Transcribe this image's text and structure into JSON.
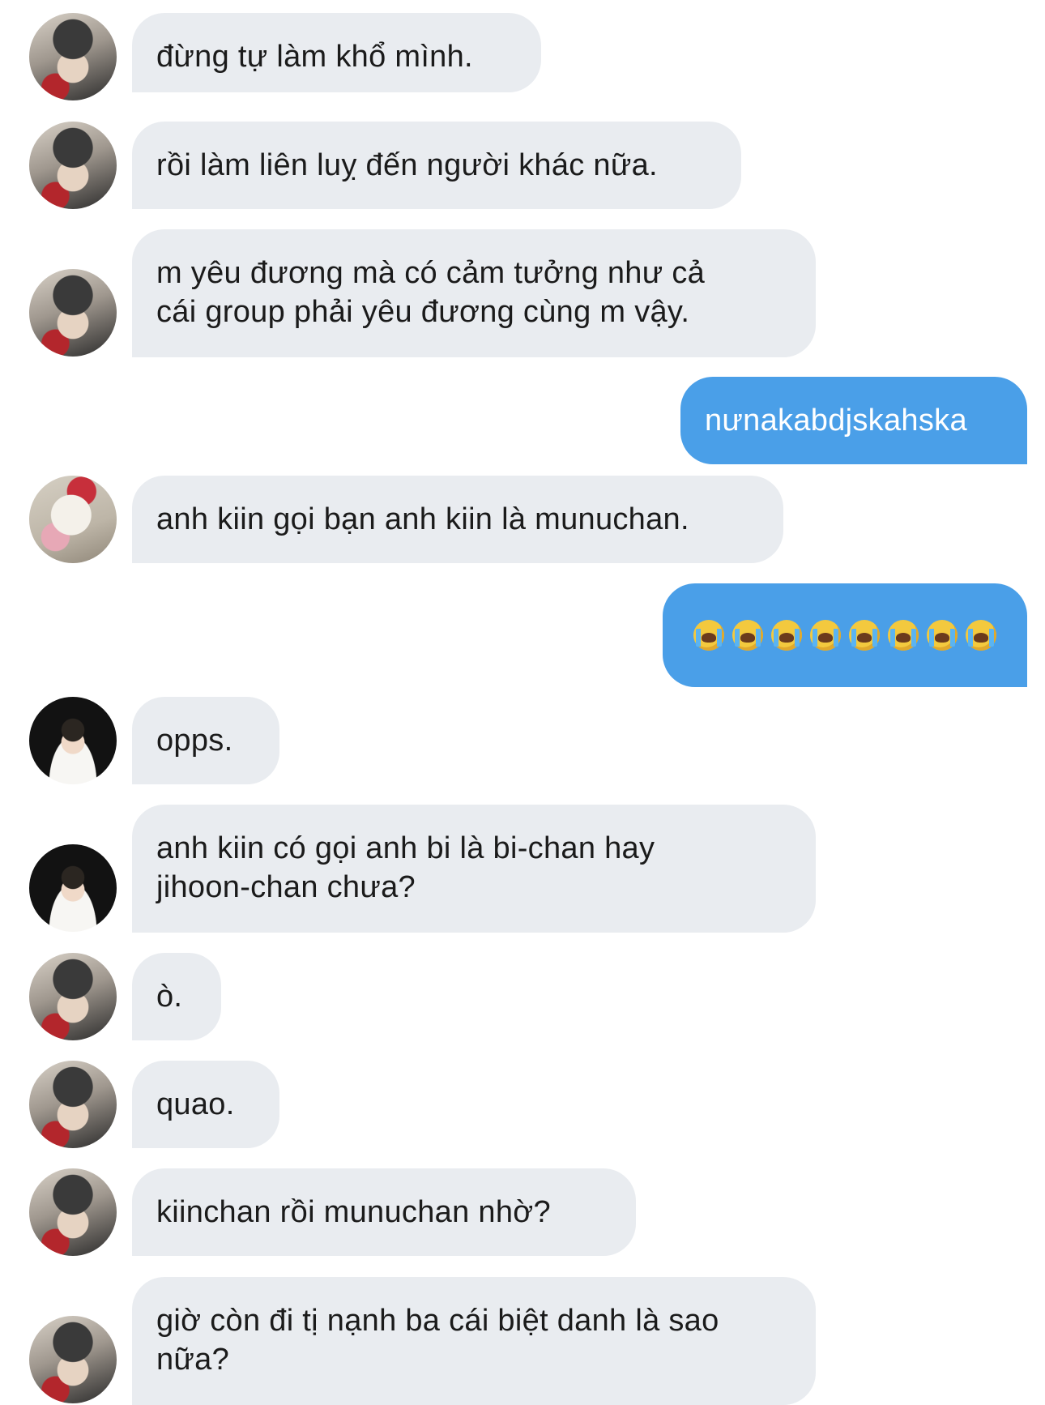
{
  "messages": [
    {
      "text": "đừng tự làm khổ mình."
    },
    {
      "text": "rồi làm liên luỵ đến người khác nữa."
    },
    {
      "text": "m yêu đương mà có cảm tưởng như cả\ncái group phải yêu đương cùng m vậy."
    },
    {
      "text": "nưnakabdjskahska"
    },
    {
      "text": "anh kiin gọi bạn anh kiin là munuchan."
    },
    {
      "emoji": "loudly-crying-face",
      "count": 8
    },
    {
      "text": "opps."
    },
    {
      "text": "anh kiin có gọi anh bi là bi-chan hay\njihoon-chan chưa?"
    },
    {
      "text": "ò."
    },
    {
      "text": "quao."
    },
    {
      "text": "kiinchan rồi munuchan nhờ?"
    },
    {
      "text": "giờ còn đi tị nạnh ba cái biệt danh là sao\nnữa?"
    }
  ],
  "colors": {
    "incoming_bubble": "#e9ecf0",
    "outgoing_bubble": "#4a9fe8"
  }
}
